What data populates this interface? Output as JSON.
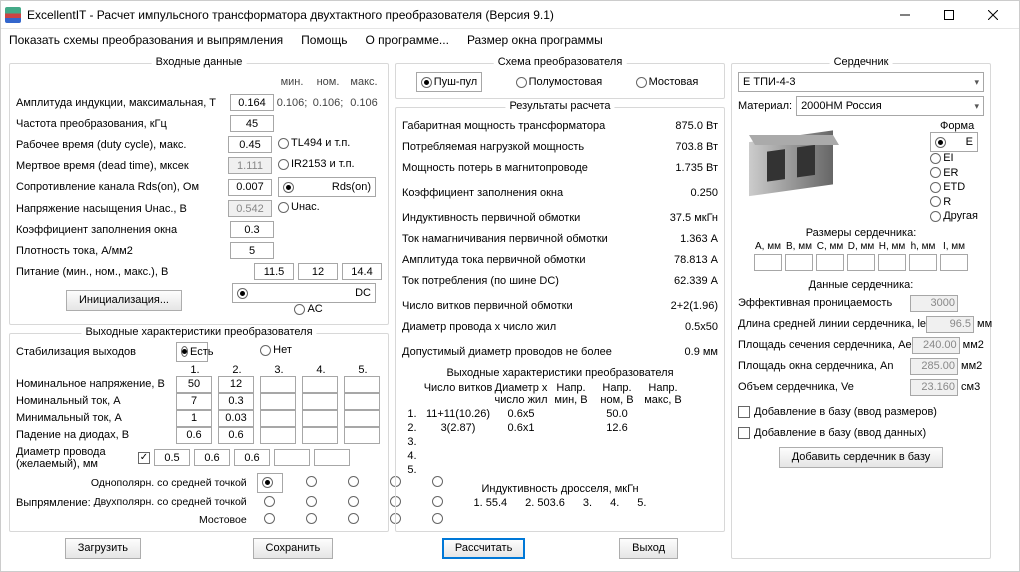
{
  "title": "ExcellentIT - Расчет импульсного трансформатора двухтактного преобразователя (Версия 9.1)",
  "menu": [
    "Показать схемы преобразования и выпрямления",
    "Помощь",
    "О программе...",
    "Размер окна программы"
  ],
  "input": {
    "heading": "Входные данные",
    "cols": [
      "мин.",
      "ном.",
      "макс."
    ],
    "amp_label": "Амплитуда индукции, максимальная, Т",
    "amp_val": "0.164",
    "amp_min": "0.106;",
    "amp_nom": "0.106;",
    "amp_max": "0.106",
    "freq_label": "Частота преобразования, кГц",
    "freq_val": "45",
    "duty_label": "Рабочее время (duty cycle), макс.",
    "duty_val": "0.45",
    "dead_label": "Мертвое время (dead time), мксек",
    "dead_val": "1.111",
    "rds_label": "Сопротивление канала Rds(on), Ом",
    "rds_val": "0.007",
    "usat_label": "Напряжение насыщения Uнас., В",
    "usat_val": "0.542",
    "kfill_label": "Коэффициент заполнения окна",
    "kfill_val": "0.3",
    "jdens_label": "Плотность тока, А/мм2",
    "jdens_val": "5",
    "supply_label": "Питание (мин., ном., макс.), В",
    "supply_min": "11.5",
    "supply_nom": "12",
    "supply_max": "14.4",
    "init_btn": "Инициализация...",
    "driver_opts": [
      "TL494 и т.п.",
      "IR2153 и т.п.",
      "Rds(on)",
      "Uнас."
    ],
    "driver_sel": 2,
    "dcac": [
      "DC",
      "AC"
    ],
    "dcac_sel": 0
  },
  "out": {
    "heading": "Выходные характеристики преобразователя",
    "stab_label": "Стабилизация выходов",
    "stab_opts": [
      "Есть",
      "Нет"
    ],
    "stab_sel": 0,
    "cols": [
      "1.",
      "2.",
      "3.",
      "4.",
      "5."
    ],
    "rows": [
      {
        "l": "Номинальное напряжение, В",
        "v": [
          "50",
          "12",
          "",
          "",
          ""
        ]
      },
      {
        "l": "Номинальный ток, А",
        "v": [
          "7",
          "0.3",
          "",
          "",
          ""
        ]
      },
      {
        "l": "Минимальный ток, А",
        "v": [
          "1",
          "0.03",
          "",
          "",
          ""
        ]
      },
      {
        "l": "Падение на диодах, В",
        "v": [
          "0.6",
          "0.6",
          "",
          "",
          ""
        ]
      }
    ],
    "diam_label": "Диаметр провода (желаемый), мм",
    "diam_chk": true,
    "diam_v": [
      "0.5",
      "0.6",
      "0.6",
      "",
      ""
    ],
    "rect_label": "Выпрямление:",
    "rect_rows": [
      "Однополярн. со средней точкой",
      "Двухполярн. со средней точкой",
      "Мостовое"
    ],
    "rect_sel": [
      0,
      -1,
      -1,
      -1,
      -1
    ]
  },
  "scheme": {
    "heading": "Схема преобразователя",
    "opts": [
      "Пуш-пул",
      "Полумостовая",
      "Мостовая"
    ],
    "sel": 0
  },
  "results": {
    "heading": "Результаты расчета",
    "lines": [
      [
        "Габаритная мощность трансформатора",
        "875.0 Вт"
      ],
      [
        "Потребляемая нагрузкой мощность",
        "703.8 Вт"
      ],
      [
        "Мощность потерь в магнитопроводе",
        "1.735 Вт"
      ],
      [
        "Коэффициент заполнения окна",
        "0.250"
      ],
      [
        "Индуктивность первичной обмотки",
        "37.5 мкГн"
      ],
      [
        "Ток намагничивания первичной обмотки",
        "1.363 А"
      ],
      [
        "Амплитуда тока первичной обмотки",
        "78.813 А"
      ],
      [
        "Ток потребления (по шине DC)",
        "62.339 А"
      ],
      [
        "Число витков первичной обмотки",
        "2+2(1.96)"
      ],
      [
        "Диаметр провода x число жил",
        "0.5x50"
      ],
      [
        "Допустимый диаметр проводов не более",
        "0.9 мм"
      ]
    ],
    "outhdr": "Выходные характеристики преобразователя",
    "outcols": [
      "",
      "Число витков",
      "Диаметр x число жил",
      "Напр. мин, В",
      "Напр. ном, В",
      "Напр. макс, В"
    ],
    "outrows": [
      [
        "1.",
        "11+11(10.26)",
        "0.6x5",
        "",
        "50.0",
        ""
      ],
      [
        "2.",
        "3(2.87)",
        "0.6x1",
        "",
        "12.6",
        ""
      ],
      [
        "3.",
        "",
        "",
        "",
        "",
        ""
      ],
      [
        "4.",
        "",
        "",
        "",
        "",
        ""
      ],
      [
        "5.",
        "",
        "",
        "",
        "",
        ""
      ]
    ],
    "ind_label": "Индуктивность дросселя, мкГн",
    "ind": [
      "1.  55.4",
      "2.  503.6",
      "3.",
      "4.",
      "5."
    ]
  },
  "core": {
    "heading": "Сердечник",
    "sel": "Е ТПИ-4-3",
    "mat_label": "Материал:",
    "mat": "2000НМ Россия",
    "shape_label": "Форма",
    "shapes": [
      "E",
      "EI",
      "ER",
      "ETD",
      "R",
      "Другая"
    ],
    "shape_sel": 0,
    "dims_label": "Размеры сердечника:",
    "dims": [
      "A, мм",
      "B, мм",
      "C, мм",
      "D, мм",
      "H, мм",
      "h, мм",
      "I, мм"
    ],
    "data_label": "Данные сердечника:",
    "data": [
      [
        "Эффективная проницаемость",
        "3000",
        ""
      ],
      [
        "Длина средней линии сердечника, le",
        "96.5",
        "мм"
      ],
      [
        "Площадь сечения сердечника, Ae",
        "240.00",
        "мм2"
      ],
      [
        "Площадь окна сердечника, An",
        "285.00",
        "мм2"
      ],
      [
        "Объем сердечника, Ve",
        "23.160",
        "см3"
      ]
    ],
    "chk1": "Добавление в базу (ввод размеров)",
    "chk2": "Добавление в базу (ввод данных)",
    "addbtn": "Добавить сердечник в базу"
  },
  "btns": {
    "load": "Загрузить",
    "save": "Сохранить",
    "calc": "Рассчитать",
    "exit": "Выход"
  }
}
